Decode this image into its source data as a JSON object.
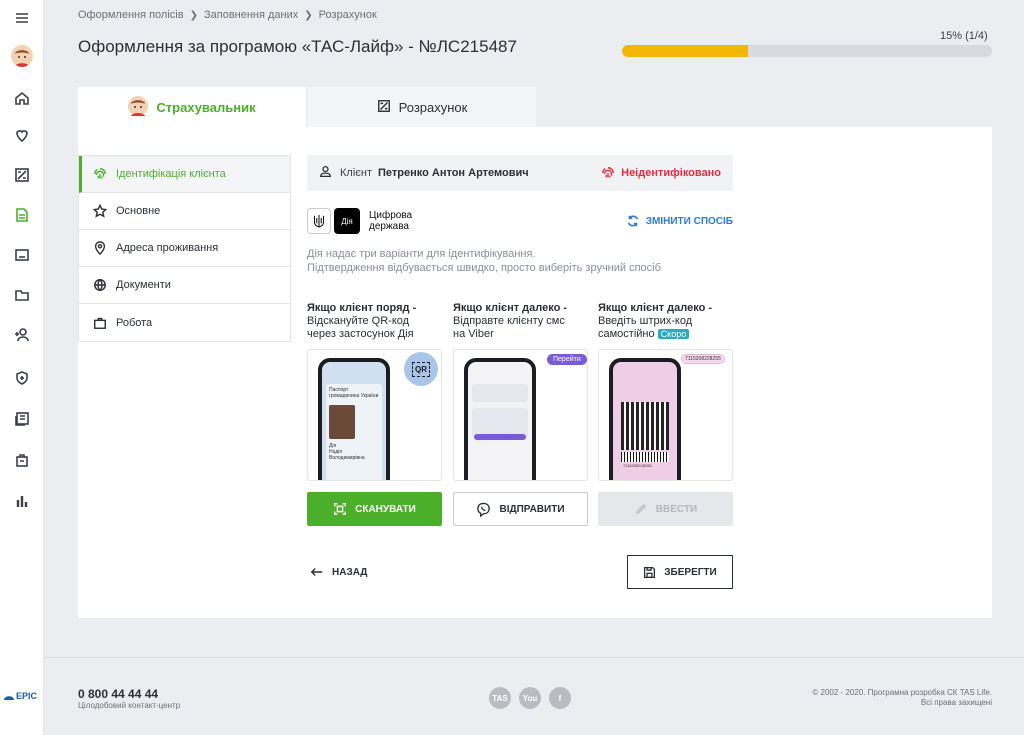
{
  "breadcrumb": [
    "Оформлення полісів",
    "Заповнення даних",
    "Розрахунок"
  ],
  "page_title": "Оформлення за програмою «ТАС-Лайф» - №ЛС215487",
  "progress": {
    "label": "15% (1/4)",
    "fraction": 0.34
  },
  "tabs": [
    {
      "label": "Страхувальник",
      "active": true
    },
    {
      "label": "Розрахунок",
      "active": false
    }
  ],
  "menu": [
    {
      "label": "Ідентифікація клієнта",
      "icon": "fingerprint-icon",
      "active": true
    },
    {
      "label": "Основне",
      "icon": "star-icon"
    },
    {
      "label": "Адреса проживання",
      "icon": "location-pin-icon"
    },
    {
      "label": "Документи",
      "icon": "globe-icon"
    },
    {
      "label": "Робота",
      "icon": "briefcase-icon"
    }
  ],
  "client": {
    "label": "Клієнт",
    "name": "Петренко  Антон Артемович",
    "status": "Неідентифіковано"
  },
  "diia": {
    "logo": "Дія",
    "text_line1": "Цифрова",
    "text_line2": "держава",
    "change": "ЗМІНИТИ СПОСІБ"
  },
  "info": [
    "Дія надає три варіанти для ідентифікування.",
    "Підтвердження відбувається швидко, просто виберіть зручний спосіб"
  ],
  "methods": [
    {
      "title": "Якщо клієнт поряд -",
      "desc1": "Відскануйте QR-код",
      "desc2": "через застосунок Дія",
      "button": "СКАНУВАТИ"
    },
    {
      "title": "Якщо клієнт далеко -",
      "desc1": "Відправте клієнту смс",
      "desc2": "на Viber",
      "button": "ВІДПРАВИТИ"
    },
    {
      "title": "Якщо клієнт далеко -",
      "desc1": "Введіть штрих-код",
      "desc2": "самостійно",
      "badge": "Скоро",
      "button": "ВВЕСТИ"
    }
  ],
  "card_texts": {
    "qr": "QR",
    "passport_title": "Паспорт громадянина України",
    "passport_name1": "Дія",
    "passport_name2": "Надія",
    "passport_name3": "Володимирівна",
    "viber_btn": "Перейти",
    "barcode_code": "7115208228255",
    "barcode_digits": "7115208228255"
  },
  "actions": {
    "back": "НАЗАД",
    "save": "ЗБЕРЕГТИ"
  },
  "footer": {
    "phone": "0 800 44 44 44",
    "phone_sub": "Цілодобовий контакт-центр",
    "copyright1": "© 2002 - 2020. Програмна розробка СК TAS Life.",
    "copyright2": "Всі права захищені",
    "socials": [
      "TAS",
      "You",
      "f"
    ],
    "logo": "EPIC"
  },
  "colors": {
    "green": "#4caf2a",
    "red": "#e0303c",
    "blue": "#2b7bd6",
    "yellow": "#f2b705"
  }
}
